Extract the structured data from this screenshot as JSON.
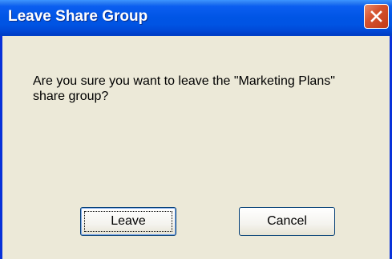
{
  "dialog": {
    "title": "Leave Share Group",
    "message": "Are you sure you want to leave the \"Marketing Plans\" share group?",
    "close_icon": "close-icon",
    "buttons": {
      "leave_label": "Leave",
      "cancel_label": "Cancel"
    },
    "colors": {
      "titlebar": "#0054e3",
      "background": "#ece9d8",
      "close_button": "#d5532f"
    }
  }
}
